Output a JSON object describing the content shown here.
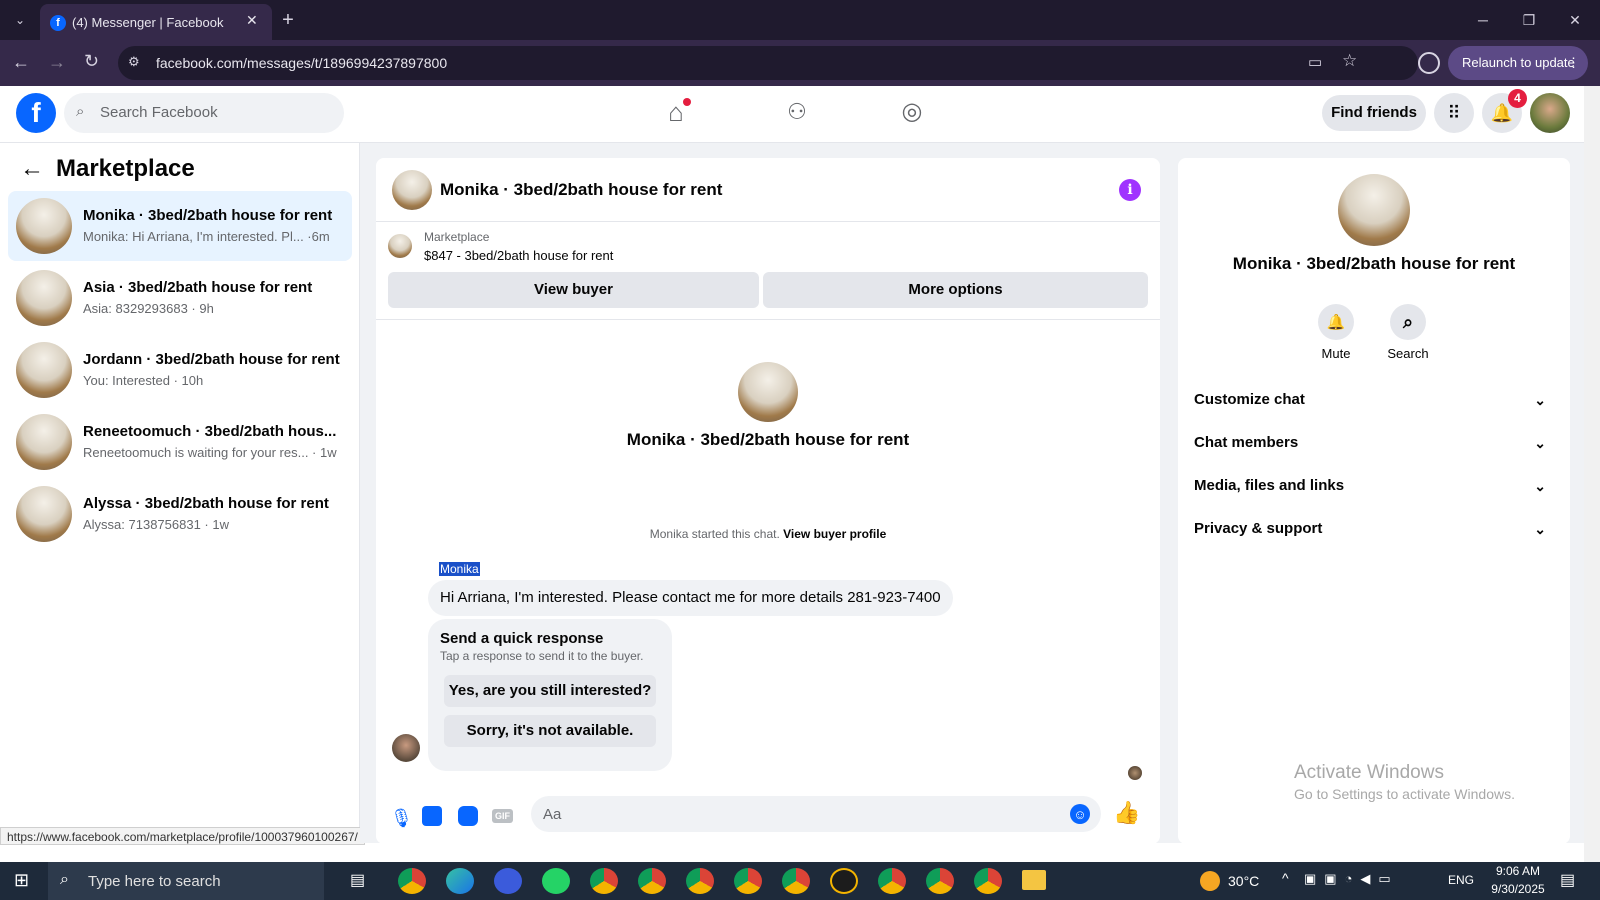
{
  "browser": {
    "tab_title": "(4) Messenger | Facebook",
    "url": "facebook.com/messages/t/1896994237897800",
    "relaunch": "Relaunch to update",
    "status_url": "https://www.facebook.com/marketplace/profile/100037960100267/"
  },
  "header": {
    "search_placeholder": "Search Facebook",
    "find_friends": "Find friends",
    "notif_count": "4"
  },
  "sidebar": {
    "title": "Marketplace",
    "conversations": [
      {
        "name": "Monika · 3bed/2bath house for rent",
        "preview": "Monika: Hi Arriana, I'm interested. Pl... ·6m"
      },
      {
        "name": "Asia · 3bed/2bath house for rent",
        "preview": "Asia: 8329293683 · 9h"
      },
      {
        "name": "Jordann · 3bed/2bath house for rent",
        "preview": "You: Interested · 10h"
      },
      {
        "name": "Reneetoomuch · 3bed/2bath hous...",
        "preview": "Reneetoomuch is waiting for your res... · 1w"
      },
      {
        "name": "Alyssa · 3bed/2bath house for rent",
        "preview": "Alyssa: 7138756831 · 1w"
      }
    ]
  },
  "chat": {
    "title": "Monika · 3bed/2bath house for rent",
    "listing_source": "Marketplace",
    "listing": "$847 - 3bed/2bath house for rent",
    "view_buyer": "View buyer",
    "more_options": "More options",
    "center_name": "Monika · 3bed/2bath house for rent",
    "started_text": "Monika started this chat.",
    "view_buyer_profile": "View buyer profile",
    "sender": "Monika",
    "message": "Hi Arriana, I'm interested.  Please contact me for more details 281-923-7400",
    "quick_title": "Send a quick response",
    "quick_sub": "Tap a response to send it to the buyer.",
    "quick1": "Yes, are you still interested?",
    "quick2": "Sorry, it's not available.",
    "composer_placeholder": "Aa",
    "gif_label": "GIF"
  },
  "info": {
    "name": "Monika · 3bed/2bath house for rent",
    "mute": "Mute",
    "search": "Search",
    "sections": [
      "Customize chat",
      "Chat members",
      "Media, files and links",
      "Privacy & support"
    ]
  },
  "watermark": {
    "line1": "Activate Windows",
    "line2": "Go to Settings to activate Windows."
  },
  "taskbar": {
    "search": "Type here to search",
    "temp": "30°C",
    "lang": "ENG",
    "time": "9:06 AM",
    "date": "9/30/2025"
  },
  "colors": {
    "fb_blue": "#0866ff",
    "accent_purple": "#a033ff",
    "chrome_bg": "#35294a"
  }
}
